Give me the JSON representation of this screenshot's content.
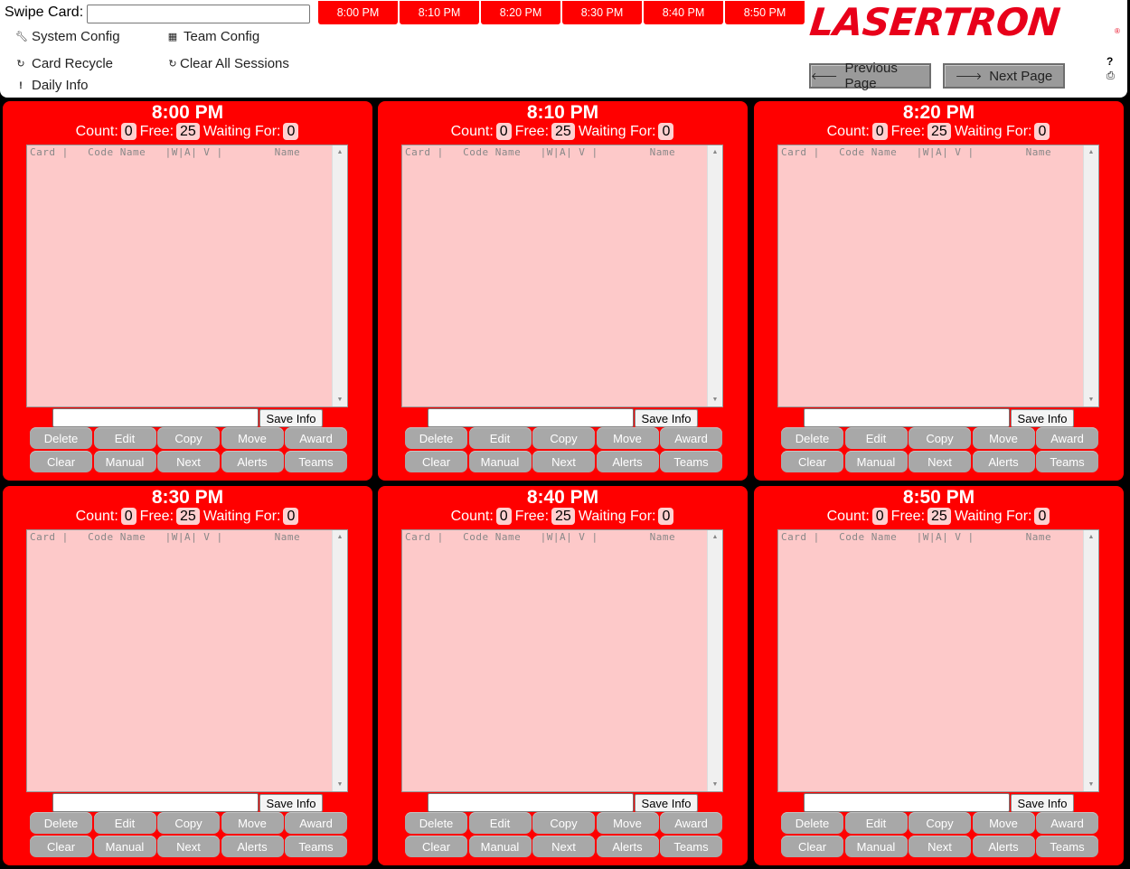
{
  "header": {
    "swipe_label": "Swipe Card:",
    "swipe_value": "",
    "menu": {
      "system_config": "System Config",
      "team_config": "Team Config",
      "card_recycle": "Card Recycle",
      "clear_all_sessions": "Clear All Sessions",
      "daily_info": "Daily Info"
    },
    "icons": {
      "system_config": "wrench-icon",
      "team_config": "grid-icon",
      "card_recycle": "recycle-icon",
      "clear_all_sessions": "refresh-icon",
      "daily_info": "exclamation-icon",
      "help": "question-icon",
      "print": "print-icon"
    },
    "time_tabs": [
      "8:00 PM",
      "8:10 PM",
      "8:20 PM",
      "8:30 PM",
      "8:40 PM",
      "8:50 PM"
    ],
    "logo": "LASERTRON",
    "logo_mark": "®",
    "prev_page": "Previous Page",
    "next_page": "Next Page",
    "help": "?",
    "print": "⎙"
  },
  "labels": {
    "count": "Count:",
    "free": "Free:",
    "waiting": "Waiting For:",
    "list_header": "Card |   Code Name   |W|A| V |        Name",
    "save_info": "Save Info",
    "buttons": [
      "Delete",
      "Edit",
      "Copy",
      "Move",
      "Award",
      "Clear",
      "Manual",
      "Next",
      "Alerts",
      "Teams"
    ]
  },
  "sessions": [
    {
      "time": "8:00 PM",
      "count": "0",
      "free": "25",
      "waiting": "0"
    },
    {
      "time": "8:10 PM",
      "count": "0",
      "free": "25",
      "waiting": "0"
    },
    {
      "time": "8:20 PM",
      "count": "0",
      "free": "25",
      "waiting": "0"
    },
    {
      "time": "8:30 PM",
      "count": "0",
      "free": "25",
      "waiting": "0"
    },
    {
      "time": "8:40 PM",
      "count": "0",
      "free": "25",
      "waiting": "0"
    },
    {
      "time": "8:50 PM",
      "count": "0",
      "free": "25",
      "waiting": "0"
    }
  ],
  "colors": {
    "panel_bg": "#ff0000",
    "list_bg": "#fdc9c9",
    "button_bg": "#a8a8a8",
    "logo": "#e8001a"
  }
}
